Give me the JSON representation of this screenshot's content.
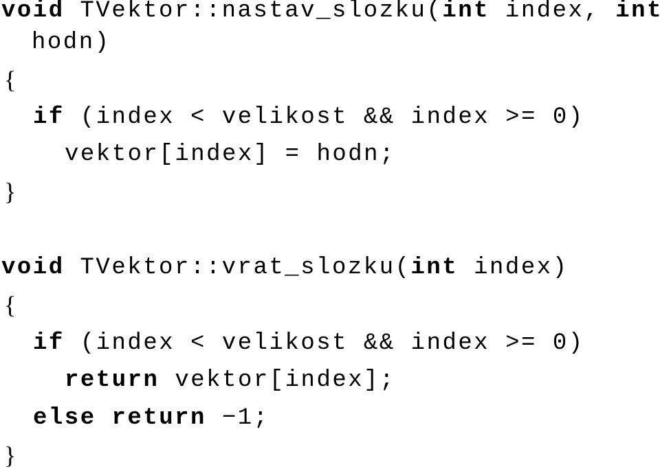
{
  "code": {
    "func1": {
      "line1": {
        "kw_void": "void",
        "name": " TVektor::nastav_slozku(",
        "kw_int1": "int",
        "param1": " index, ",
        "kw_int2": "int"
      },
      "line2": "hodn)",
      "open_brace": "{",
      "if_line": {
        "kw_if": "if",
        "cond": " (index < velikost && index >= 0)"
      },
      "body": "vektor[index] = hodn;",
      "close_brace": "}"
    },
    "func2": {
      "line1": {
        "kw_void": "void",
        "name": " TVektor::vrat_slozku(",
        "kw_int": "int",
        "param": " index)"
      },
      "open_brace": "{",
      "if_line": {
        "kw_if": "if",
        "cond": " (index < velikost && index >= 0)"
      },
      "return_line": {
        "kw_return": "return",
        "expr": " vektor[index];"
      },
      "else_line": {
        "kw_else": "else",
        "sp": " ",
        "kw_return": "return",
        "expr": " −1;"
      },
      "close_brace": "}"
    }
  }
}
